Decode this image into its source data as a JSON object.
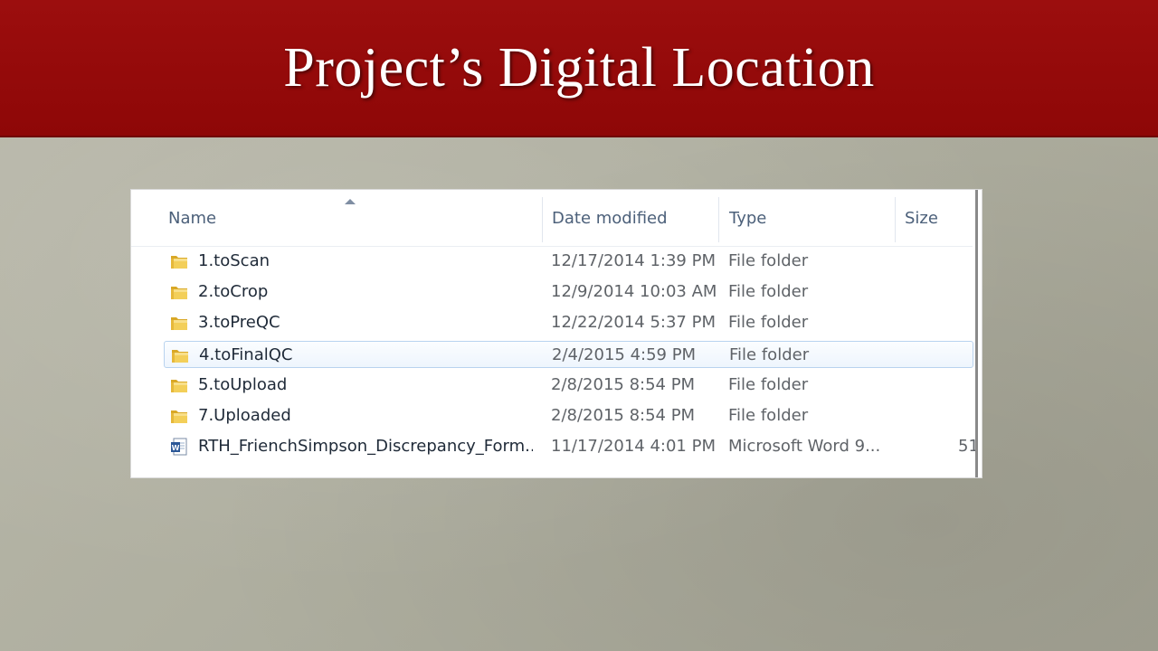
{
  "slide": {
    "title": "Project’s Digital Location"
  },
  "explorer": {
    "columns": {
      "name": "Name",
      "date": "Date modified",
      "type": "Type",
      "size": "Size"
    },
    "rows": [
      {
        "name": "1.toScan",
        "date": "12/17/2014 1:39 PM",
        "type": "File folder",
        "size": "",
        "icon": "folder-icon"
      },
      {
        "name": "2.toCrop",
        "date": "12/9/2014 10:03 AM",
        "type": "File folder",
        "size": "",
        "icon": "folder-icon"
      },
      {
        "name": "3.toPreQC",
        "date": "12/22/2014 5:37 PM",
        "type": "File folder",
        "size": "",
        "icon": "folder-icon"
      },
      {
        "name": "4.toFinalQC",
        "date": "2/4/2015 4:59 PM",
        "type": "File folder",
        "size": "",
        "icon": "folder-icon",
        "selected": true
      },
      {
        "name": "5.toUpload",
        "date": "2/8/2015 8:54 PM",
        "type": "File folder",
        "size": "",
        "icon": "folder-icon"
      },
      {
        "name": "7.Uploaded",
        "date": "2/8/2015 8:54 PM",
        "type": "File folder",
        "size": "",
        "icon": "folder-icon"
      },
      {
        "name": "RTH_FrienchSimpson_Discrepancy_Form...",
        "date": "11/17/2014 4:01 PM",
        "type": "Microsoft Word 9...",
        "size": "51",
        "icon": "word-document-icon"
      }
    ]
  }
}
